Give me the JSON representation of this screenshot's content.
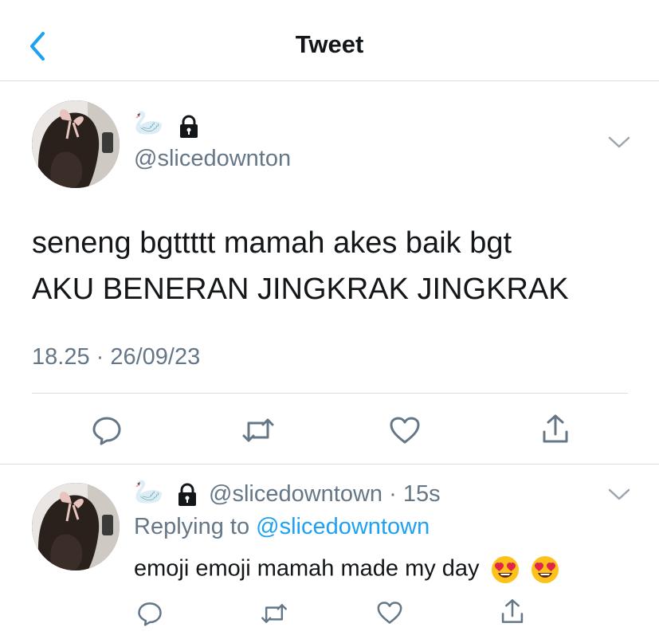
{
  "nav": {
    "title": "Tweet"
  },
  "tweet": {
    "handle": "@slicedownton",
    "text_line1": "seneng bgttttt mamah akes baik bgt",
    "text_line2": "AKU BENERAN JINGKRAK JINGKRAK",
    "timestamp": "18.25 · 26/09/23"
  },
  "reply": {
    "handle": "@slicedowntown",
    "separator": "·",
    "age": "15s",
    "replying_prefix": "Replying to",
    "replying_handle": "@slicedowntown",
    "text": "emoji emoji mamah made my day"
  },
  "colors": {
    "accent": "#1da1f2",
    "secondary_text": "#657786",
    "divider": "#dcdcdc"
  },
  "icons": {
    "back": "chevron-left-icon",
    "name_emoji": "swan",
    "protected": "lock-icon",
    "menu": "chevron-down-icon",
    "actions": [
      "reply-icon",
      "retweet-icon",
      "like-icon",
      "share-icon"
    ],
    "reply_emojis": [
      "heart-eyes-emoji",
      "heart-eyes-emoji"
    ]
  }
}
